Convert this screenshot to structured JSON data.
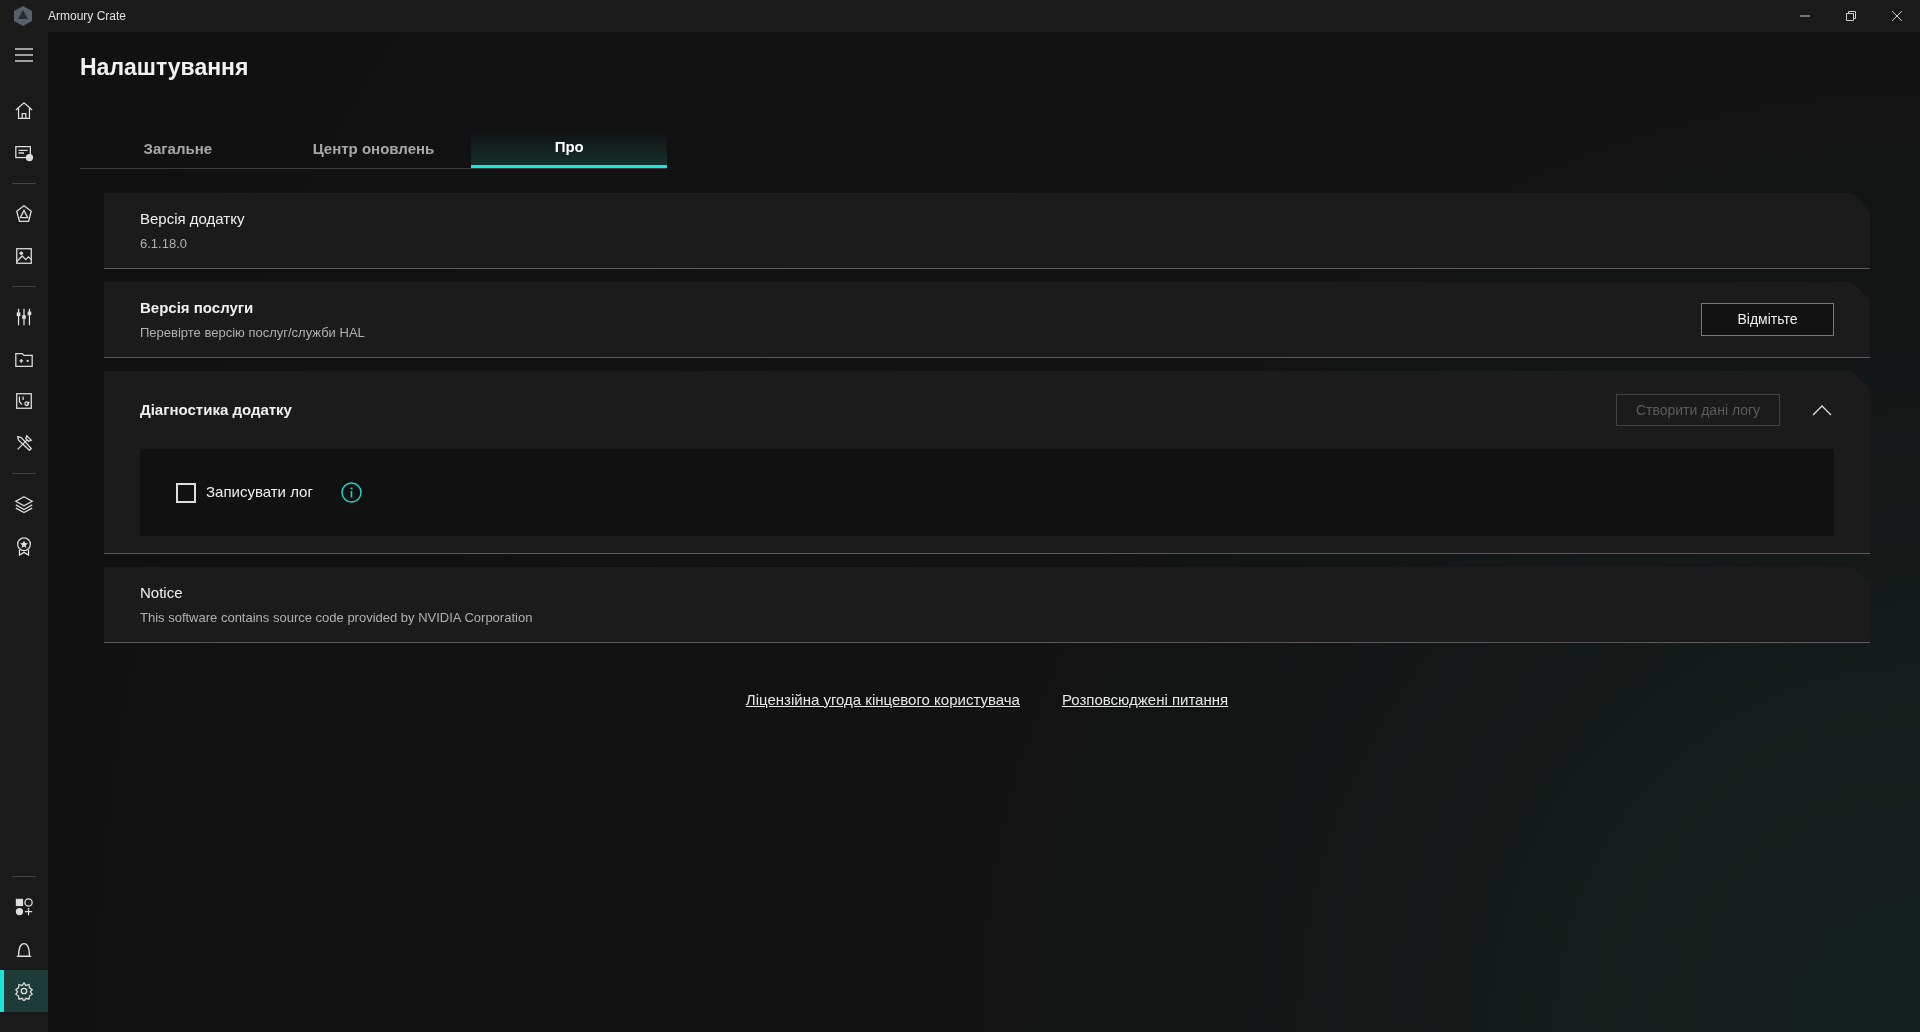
{
  "window": {
    "title": "Armoury Crate"
  },
  "sidebar": {
    "groups": [
      {
        "items": [
          {
            "selected": false
          },
          {
            "selected": false
          }
        ]
      },
      {
        "items": [
          {
            "selected": false
          },
          {
            "selected": false
          }
        ]
      },
      {
        "items": [
          {
            "selected": false
          },
          {
            "selected": false
          },
          {
            "selected": false
          },
          {
            "selected": false
          }
        ]
      },
      {
        "items": [
          {
            "selected": false
          },
          {
            "selected": false
          }
        ]
      },
      {
        "items": [
          {
            "selected": false
          },
          {
            "selected": false
          },
          {
            "selected": true
          }
        ]
      }
    ]
  },
  "page_title": "Налаштування",
  "tabs": [
    {
      "label": "Загальне",
      "selected": false
    },
    {
      "label": "Центр оновлень",
      "selected": false
    },
    {
      "label": "Про",
      "selected": true
    }
  ],
  "cards": [
    {
      "kind": "info",
      "title": "Версія додатку",
      "bold": false,
      "subtitle": "6.1.18.0"
    },
    {
      "kind": "button",
      "title": "Версія послуги",
      "bold": true,
      "subtitle": "Перевірте версію послуг/служби HAL",
      "button": "Відмітьте"
    },
    {
      "kind": "diagnostics",
      "title": "Діагностика додатку",
      "bold": true,
      "button": {
        "label": "Створити дані логу",
        "disabled": true
      },
      "expanded": true,
      "checkbox": {
        "label": "Записувати лог",
        "checked": false
      }
    },
    {
      "kind": "info",
      "title": "Notice",
      "bold": false,
      "subtitle": "This software contains source code provided by NVIDIA Corporation"
    }
  ],
  "links": [
    "Ліцензійна угода кінцевого користувача",
    "Розповсюджені питання"
  ]
}
